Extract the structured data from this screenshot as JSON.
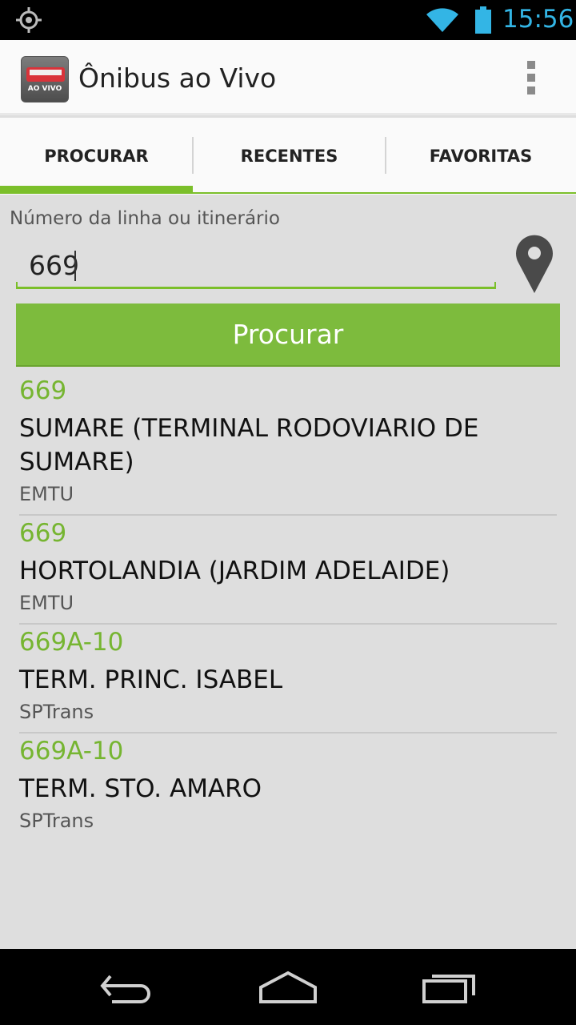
{
  "status_bar": {
    "time": "15:56",
    "icons": [
      "gps-icon",
      "wifi-icon",
      "battery-icon"
    ],
    "accent_color": "#33b5e5"
  },
  "action_bar": {
    "app_icon_text": "AO VIVO",
    "title": "Ônibus ao Vivo",
    "overflow_icon": "overflow-menu-icon"
  },
  "tabs": [
    {
      "label": "PROCURAR",
      "active": true
    },
    {
      "label": "RECENTES",
      "active": false
    },
    {
      "label": "FAVORITAS",
      "active": false
    }
  ],
  "search": {
    "label": "Número da linha ou itinerário",
    "value": "669",
    "button_label": "Procurar",
    "location_icon": "map-pin-icon"
  },
  "results": [
    {
      "code": "669",
      "name": "SUMARE (TERMINAL RODOVIARIO DE SUMARE)",
      "agency": "EMTU"
    },
    {
      "code": "669",
      "name": "HORTOLANDIA (JARDIM ADELAIDE)",
      "agency": "EMTU"
    },
    {
      "code": "669A-10",
      "name": "TERM. PRINC. ISABEL",
      "agency": "SPTrans"
    },
    {
      "code": "669A-10",
      "name": "TERM. STO. AMARO",
      "agency": "SPTrans"
    }
  ],
  "nav_bar": {
    "buttons": [
      "back-icon",
      "home-icon",
      "recent-apps-icon"
    ]
  },
  "colors": {
    "brand_green": "#7dbb3d",
    "code_green": "#76b531",
    "background": "#dedede"
  }
}
